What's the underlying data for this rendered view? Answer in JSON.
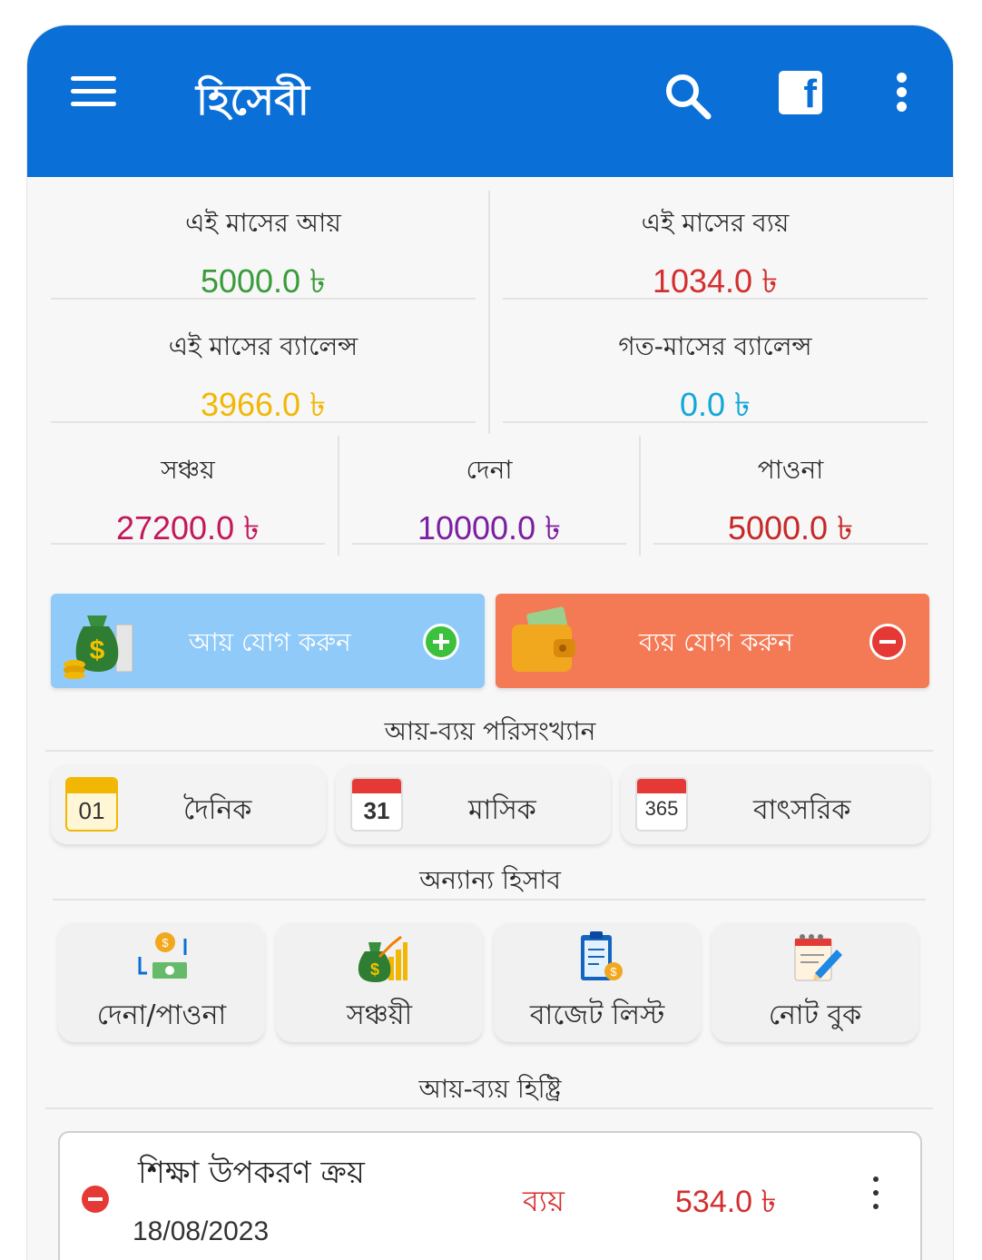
{
  "colors": {
    "primary": "#0a6fd6",
    "income_green": "#3a9b3a",
    "expense_red": "#d32f2f",
    "balance_yellow": "#f2b705",
    "prev_balance_blue": "#12a7d8",
    "savings_crimson": "#c2185b",
    "debt_purple": "#7b1fa2",
    "receivable_red": "#c62828",
    "add_income_bg": "#90caf9",
    "add_expense_bg": "#f47a56"
  },
  "appbar": {
    "title": "হিসেবী",
    "icons": [
      "menu-icon",
      "search-icon",
      "facebook-icon",
      "more-vert-icon"
    ]
  },
  "summary": {
    "month_income": {
      "label": "এই মাসের আয়",
      "value": "5000.0 ৳"
    },
    "month_expense": {
      "label": "এই মাসের ব্যয়",
      "value": "1034.0 ৳"
    },
    "month_balance": {
      "label": "এই মাসের ব্যালেন্স",
      "value": "3966.0 ৳"
    },
    "prev_balance": {
      "label": "গত-মাসের ব্যালেন্স",
      "value": "0.0 ৳"
    },
    "savings": {
      "label": "সঞ্চয়",
      "value": "27200.0 ৳"
    },
    "debt": {
      "label": "দেনা",
      "value": "10000.0 ৳"
    },
    "receivable": {
      "label": "পাওনা",
      "value": "5000.0 ৳"
    }
  },
  "actions": {
    "add_income": "আয় যোগ করুন",
    "add_expense": "ব্যয় যোগ করুন"
  },
  "stats_section": {
    "title": "আয়-ব্যয় পরিসংখ্যান",
    "daily": {
      "label": "দৈনিক",
      "cal": "01"
    },
    "monthly": {
      "label": "মাসিক",
      "cal": "31"
    },
    "yearly": {
      "label": "বাৎসরিক",
      "cal": "365"
    }
  },
  "other_section": {
    "title": "অন্যান্য হিসাব",
    "tiles": [
      {
        "label": "দেনা/পাওনা",
        "icon": "money-exchange-icon"
      },
      {
        "label": "সঞ্চয়ী",
        "icon": "money-bag-growth-icon"
      },
      {
        "label": "বাজেট লিস্ট",
        "icon": "budget-clipboard-icon"
      },
      {
        "label": "নোট বুক",
        "icon": "notebook-pencil-icon"
      }
    ]
  },
  "history_section": {
    "title": "আয়-ব্যয় হিষ্ট্রি",
    "items": [
      {
        "title": "শিক্ষা উপকরণ ক্রয়",
        "date": "18/08/2023",
        "type": "ব্যয়",
        "amount": "534.0 ৳"
      }
    ]
  }
}
